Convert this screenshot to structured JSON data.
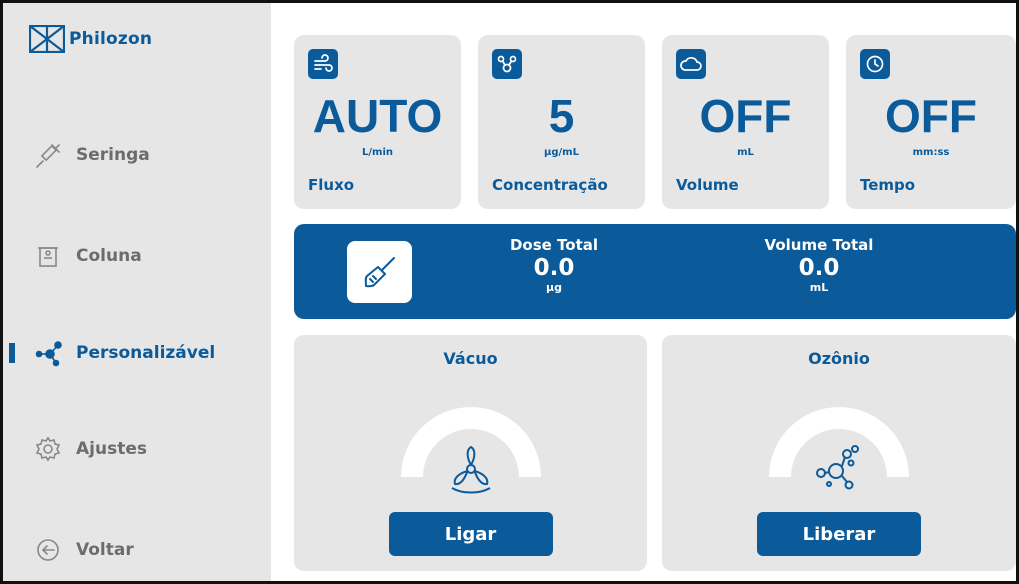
{
  "brand": {
    "name": "Philozon"
  },
  "sidebar": {
    "items": [
      {
        "label": "Seringa",
        "icon": "syringe-icon",
        "active": false
      },
      {
        "label": "Coluna",
        "icon": "column-icon",
        "active": false
      },
      {
        "label": "Personalizável",
        "icon": "customizable-icon",
        "active": true
      },
      {
        "label": "Ajustes",
        "icon": "gear-icon",
        "active": false
      },
      {
        "label": "Voltar",
        "icon": "back-arrow-icon",
        "active": false
      }
    ]
  },
  "stats": [
    {
      "label": "Fluxo",
      "value": "AUTO",
      "unit": "L/min",
      "icon": "wind-icon"
    },
    {
      "label": "Concentração",
      "value": "5",
      "unit": "µg/mL",
      "icon": "molecule-icon"
    },
    {
      "label": "Volume",
      "value": "OFF",
      "unit": "mL",
      "icon": "cloud-icon"
    },
    {
      "label": "Tempo",
      "value": "OFF",
      "unit": "mm:ss",
      "icon": "clock-icon"
    }
  ],
  "totals": {
    "dose": {
      "title": "Dose Total",
      "value": "0.0",
      "unit": "µg"
    },
    "volume": {
      "title": "Volume Total",
      "value": "0.0",
      "unit": "mL"
    },
    "icon": "brush-icon"
  },
  "controls": {
    "vacuum": {
      "title": "Vácuo",
      "button": "Ligar",
      "icon": "fan-icon"
    },
    "ozone": {
      "title": "Ozônio",
      "button": "Liberar",
      "icon": "bubbles-icon"
    }
  },
  "colors": {
    "primary": "#0b5a9a",
    "panel": "#e6e6e6",
    "muted": "#6c6c6c"
  }
}
